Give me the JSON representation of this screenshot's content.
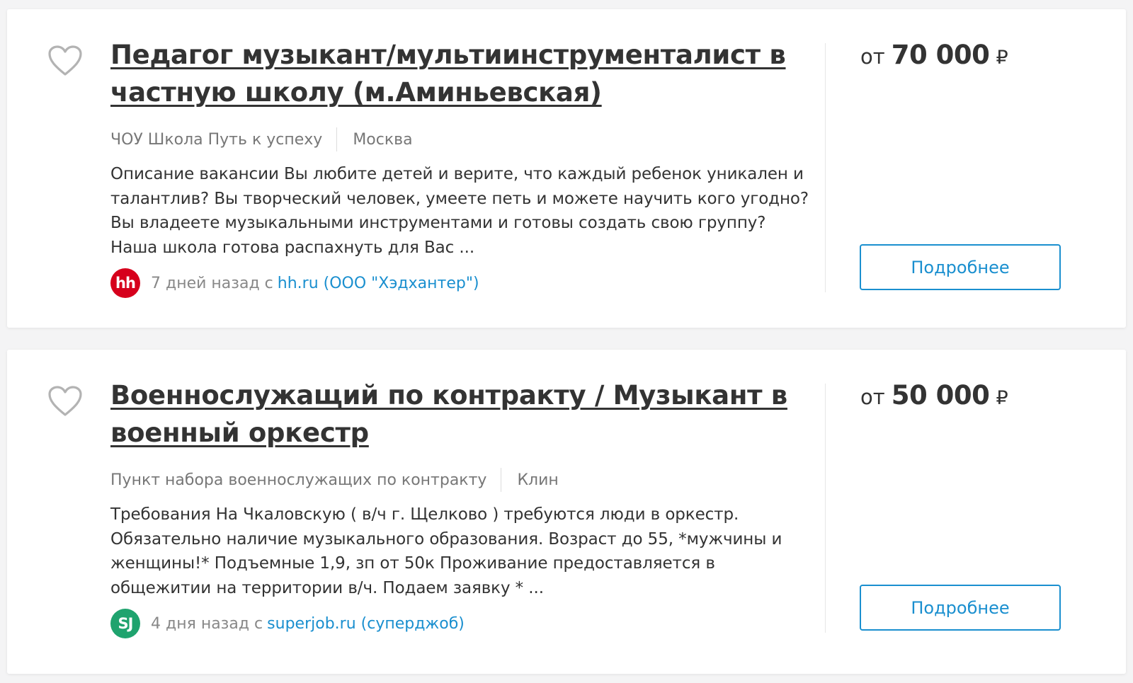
{
  "vacancies": [
    {
      "title": "Педагог музыкант/мультиинструменталист в частную школу (м.Аминьевская)",
      "company": "ЧОУ Школа Путь к успеху",
      "city": "Москва",
      "description": "Описание вакансии Вы любите детей и верите, что каждый ребенок уникален и талантлив? Вы творческий человек, умеете петь и можете научить кого угодно? Вы владеете музыкальными инструментами и готовы создать свою группу? Наша школа готова распахнуть для Вас ...",
      "source_logo": "hh",
      "source_logo_color": "#d6001c",
      "posted": "7 дней назад с",
      "source_link": "hh.ru (ООО \"Хэдхантер\")",
      "salary_from": "от",
      "salary_amount": "70 000",
      "salary_currency": "₽",
      "button_label": "Подробнее",
      "favorite_icon": "heart-outline-icon"
    },
    {
      "title": "Военнослужащий по контракту / Музыкант в военный оркестр",
      "company": "Пункт набора военнослужащих по контракту",
      "city": "Клин",
      "description": "Требования На Чкаловскую ( в/ч г. Щелково ) требуются люди в оркестр. Обязательно наличие музыкального образования. Возраст до 55, *мужчины и женщины!* Подъемные 1,9, зп от 50к Проживание предоставляется в общежитии на территории в/ч. Подаем заявку * ...",
      "source_logo": "SJ",
      "source_logo_color": "#1fa36e",
      "posted": "4 дня назад с",
      "source_link": "superjob.ru (суперджоб)",
      "salary_from": "от",
      "salary_amount": "50 000",
      "salary_currency": "₽",
      "button_label": "Подробнее",
      "favorite_icon": "heart-outline-icon"
    }
  ],
  "colors": {
    "accent": "#1a8fcf",
    "text": "#333333",
    "muted": "#777777"
  }
}
